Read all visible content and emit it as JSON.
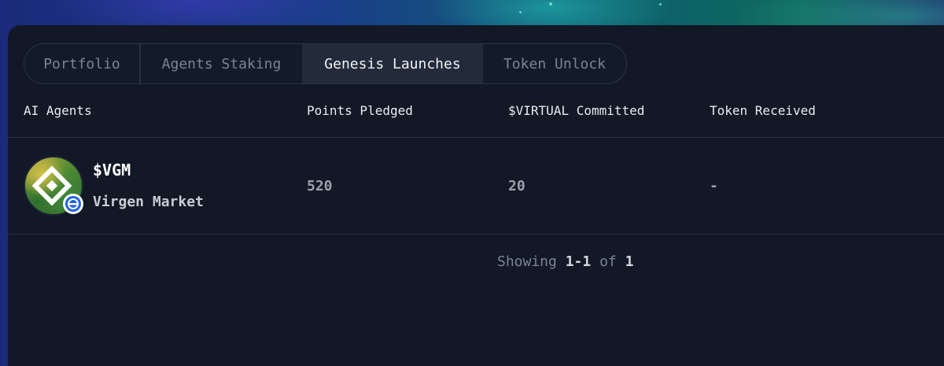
{
  "tabs": [
    {
      "label": "Portfolio",
      "active": false
    },
    {
      "label": "Agents Staking",
      "active": false
    },
    {
      "label": "Genesis Launches",
      "active": true
    },
    {
      "label": "Token Unlock",
      "active": false
    }
  ],
  "table": {
    "columns": [
      "AI Agents",
      "Points Pledged",
      "$VIRTUAL Committed",
      "Token Received"
    ],
    "rows": [
      {
        "ticker": "$VGM",
        "name": "Virgen Market",
        "avatar_icon": "virgen-market-logo",
        "points_pledged": "520",
        "virtual_committed": "20",
        "token_received": "-"
      }
    ]
  },
  "pagination": {
    "prefix": "Showing",
    "range": "1-1",
    "of_label": "of",
    "total": "1"
  },
  "colors": {
    "panel_bg": "#121826",
    "active_tab_bg": "#232b3b",
    "badge_blue": "#1f63e6"
  }
}
